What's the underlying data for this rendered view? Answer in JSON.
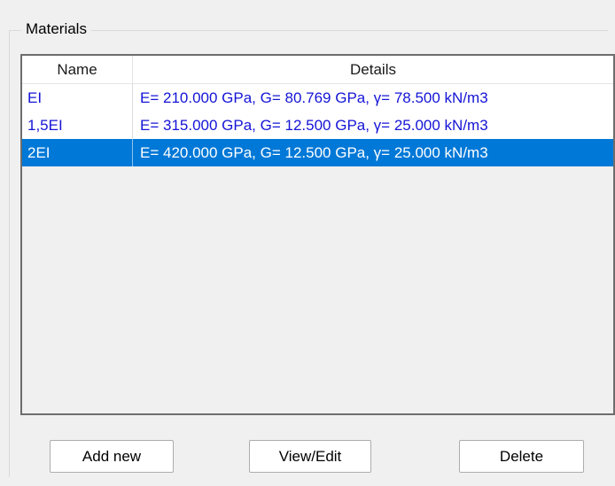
{
  "group": {
    "title": "Materials"
  },
  "list": {
    "headers": {
      "name": "Name",
      "details": "Details"
    },
    "rows": [
      {
        "name": "EI",
        "details": "E= 210.000 GPa, G= 80.769 GPa, γ= 78.500 kN/m3",
        "selected": false
      },
      {
        "name": "1,5EI",
        "details": "E= 315.000 GPa, G= 12.500 GPa, γ= 25.000 kN/m3",
        "selected": false
      },
      {
        "name": "2EI",
        "details": "E= 420.000 GPa, G= 12.500 GPa, γ= 25.000 kN/m3",
        "selected": true
      }
    ]
  },
  "buttons": {
    "add_label": "Add new",
    "view_label": "View/Edit",
    "delete_label": "Delete"
  },
  "colors": {
    "selection": "#0078d7",
    "item_text": "#1414d6",
    "window_bg": "#f0f0f0"
  }
}
